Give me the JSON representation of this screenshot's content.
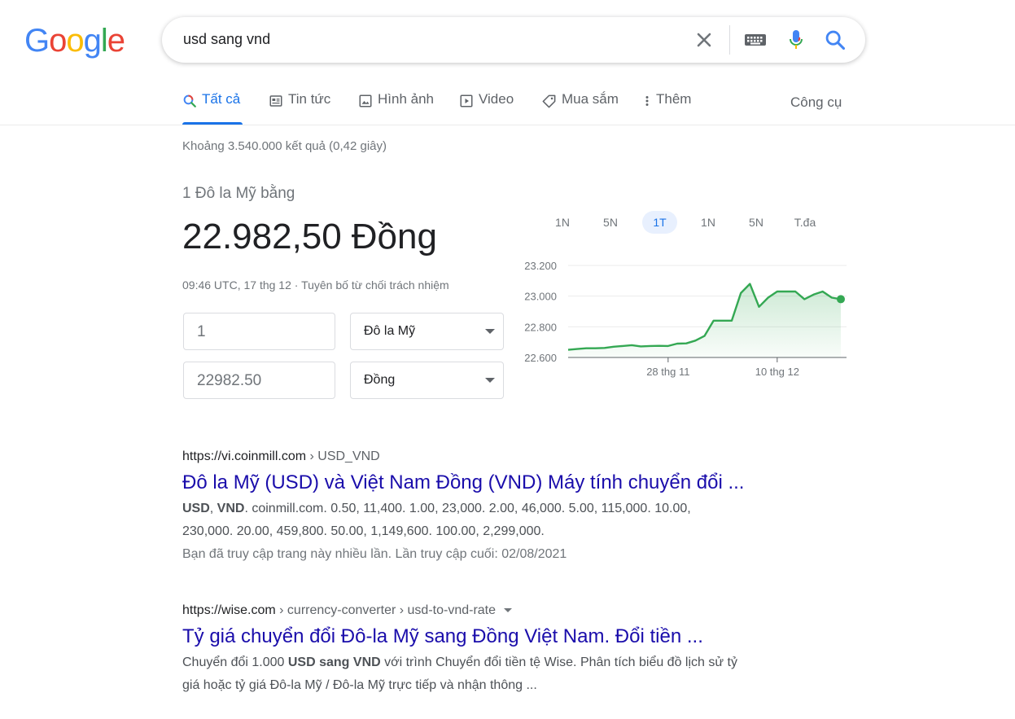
{
  "logo": {
    "letters": [
      "G",
      "o",
      "o",
      "g",
      "l",
      "e"
    ],
    "colors": [
      "#4285f4",
      "#ea4335",
      "#fbbc05",
      "#4285f4",
      "#34a853",
      "#ea4335"
    ]
  },
  "search": {
    "query": "usd sang vnd"
  },
  "tabs": [
    {
      "label": "Tất cả",
      "icon": "search-icon",
      "active": true
    },
    {
      "label": "Tin tức",
      "icon": "news-icon"
    },
    {
      "label": "Hình ảnh",
      "icon": "image-icon"
    },
    {
      "label": "Video",
      "icon": "video-icon"
    },
    {
      "label": "Mua sắm",
      "icon": "tag-icon"
    },
    {
      "label": "Thêm",
      "icon": "more-vert-icon"
    }
  ],
  "tools_label": "Công cụ",
  "stats": "Khoảng 3.540.000 kết quả (0,42 giây)",
  "converter": {
    "label": "1 Đô la Mỹ bằng",
    "value": "22.982,50",
    "unit": "Đồng",
    "timestamp": "09:46 UTC, 17 thg 12",
    "separator": "·",
    "disclaimer": "Tuyên bố từ chối trách nhiệm",
    "from_amount": "1",
    "from_currency": "Đô la Mỹ",
    "to_amount": "22982.50",
    "to_currency": "Đồng"
  },
  "chart_ranges": [
    "1N",
    "5N",
    "1T",
    "1N",
    "5N",
    "T.đa"
  ],
  "chart_active_range": "1T",
  "chart_data": {
    "type": "area",
    "ylim": [
      22600,
      23200
    ],
    "y_ticks": [
      "23.200",
      "23.000",
      "22.800",
      "22.600"
    ],
    "x_tick_labels": [
      "28 thg 11",
      "10 thg 12"
    ],
    "x": [
      "17 thg 11",
      "18 thg 11",
      "19 thg 11",
      "20 thg 11",
      "21 thg 11",
      "22 thg 11",
      "23 thg 11",
      "24 thg 11",
      "25 thg 11",
      "26 thg 11",
      "27 thg 11",
      "28 thg 11",
      "29 thg 11",
      "30 thg 11",
      "1 thg 12",
      "2 thg 12",
      "3 thg 12",
      "4 thg 12",
      "5 thg 12",
      "6 thg 12",
      "7 thg 12",
      "8 thg 12",
      "9 thg 12",
      "10 thg 12",
      "11 thg 12",
      "12 thg 12",
      "13 thg 12",
      "14 thg 12",
      "15 thg 12",
      "16 thg 12",
      "17 thg 12"
    ],
    "values": [
      22650,
      22655,
      22660,
      22660,
      22662,
      22670,
      22675,
      22680,
      22672,
      22675,
      22676,
      22675,
      22690,
      22692,
      22710,
      22740,
      22840,
      22840,
      22840,
      23020,
      23080,
      22930,
      22990,
      23030,
      23030,
      23030,
      22980,
      23010,
      23030,
      22990,
      22980
    ],
    "line_color": "#34a853",
    "grid": true
  },
  "results": [
    {
      "url_domain": "https://vi.coinmill.com",
      "url_path": " › USD_VND",
      "title": "Đô la Mỹ (USD) và Việt Nam Đồng (VND) Máy tính chuyển đổi ...",
      "snippet_bold_1": "USD",
      "snippet_sep": ", ",
      "snippet_bold_2": "VND",
      "snippet_line_1": ". coinmill.com. 0.50, 11,400. 1.00, 23,000. 2.00, 46,000. 5.00, 115,000. 10.00,",
      "snippet_line_2": "230,000. 20.00, 459,800. 50.00, 1,149,600. 100.00, 2,299,000.",
      "visited": "Bạn đã truy cập trang này nhiều lần. Lần truy cập cuối: 02/08/2021"
    },
    {
      "url_domain": "https://wise.com",
      "url_path": " › currency-converter › usd-to-vnd-rate",
      "title": "Tỷ giá chuyển đổi Đô-la Mỹ sang Đồng Việt Nam. Đổi tiền ...",
      "snippet_pre": "Chuyển đổi 1.000 ",
      "snippet_bold": "USD sang VND",
      "snippet_post": " với trình Chuyển đổi tiền tệ Wise. Phân tích biểu đồ lịch sử tỷ",
      "snippet_line_2": "giá hoặc tỷ giá Đô-la Mỹ / Đô-la Mỹ trực tiếp và nhận thông ..."
    }
  ]
}
